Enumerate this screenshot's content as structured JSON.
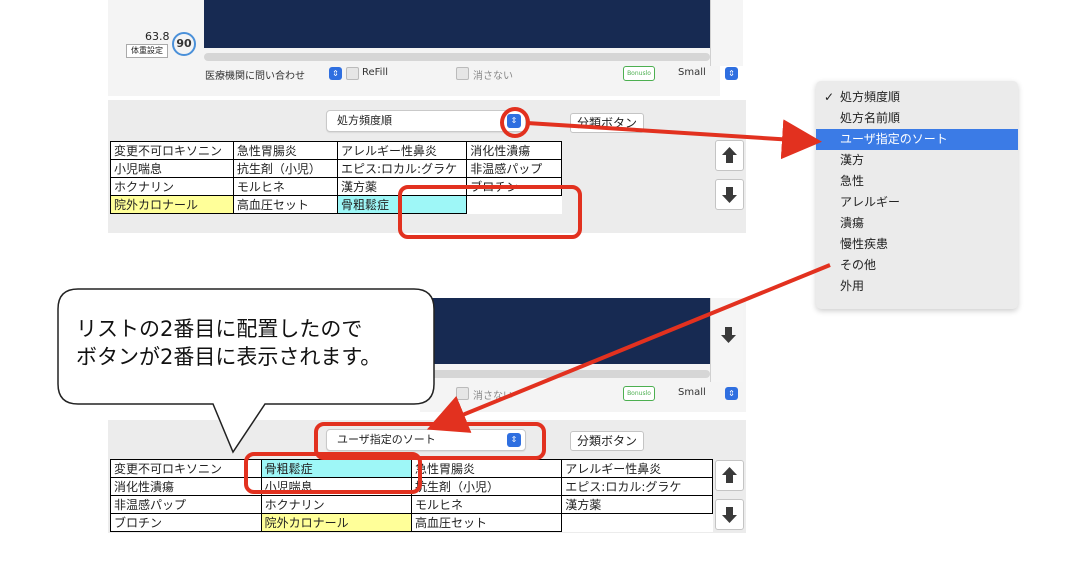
{
  "top_window": {
    "weight_value": "63.8",
    "weight_circle": "90",
    "weight_button": "体重設定",
    "toolbar_select": "医療機関に問い合わせ",
    "refill_label": "ReFill",
    "keep_label": "消さない",
    "small_label": "Small",
    "stamp_text": "Bonuslo"
  },
  "panel1": {
    "sort_select": "処方頻度順",
    "classify_button": "分類ボタン",
    "rows": [
      [
        "変更不可ロキソニン",
        "急性胃腸炎",
        "アレルギー性鼻炎",
        "消化性潰瘍"
      ],
      [
        "小児喘息",
        "抗生剤（小児）",
        "エピス:ロカル:グラケ",
        "非温感パップ"
      ],
      [
        "ホクナリン",
        "モルヒネ",
        "漢方薬",
        "ブロチン"
      ],
      [
        "院外カロナール",
        "高血圧セット",
        "骨粗鬆症",
        ""
      ]
    ]
  },
  "dropdown_menu": {
    "check_mark": "✓",
    "items": [
      "処方頻度順",
      "処方名前順",
      "ユーザ指定のソート",
      "漢方",
      "急性",
      "アレルギー",
      "潰瘍",
      "慢性疾患",
      "その他",
      "外用"
    ],
    "checked_index": 0,
    "highlighted_index": 2
  },
  "callout": {
    "line1": "リストの2番目に配置したので",
    "line2": "ボタンが2番目に表示されます。"
  },
  "bottom_window": {
    "keep_label": "消さない",
    "small_label": "Small",
    "stamp_text": "Bonuslo"
  },
  "panel2": {
    "sort_select": "ユーザ指定のソート",
    "classify_button": "分類ボタン",
    "rows": [
      [
        "変更不可ロキソニン",
        "骨粗鬆症",
        "急性胃腸炎",
        "アレルギー性鼻炎"
      ],
      [
        "消化性潰瘍",
        "小児喘息",
        "抗生剤（小児）",
        "エピス:ロカル:グラケ"
      ],
      [
        "非温感パップ",
        "ホクナリン",
        "モルヒネ",
        "漢方薬"
      ],
      [
        "ブロチン",
        "院外カロナール",
        "高血圧セット",
        ""
      ]
    ]
  },
  "colors": {
    "accent_blue": "#3b7be6",
    "annotation_red": "#e2311f",
    "dark_navy": "#172a52",
    "cyan_cell": "#9ef7f7",
    "yellow_cell": "#ffff99"
  }
}
